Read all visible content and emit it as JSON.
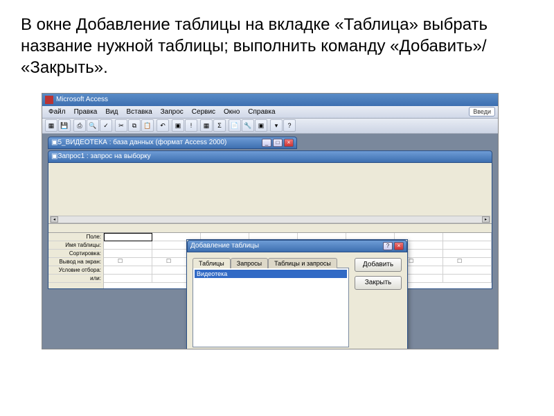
{
  "instruction_text": "В окне Добавление таблицы на вкладке «Таблица» выбрать название нужной таблицы; выполнить команду «Добавить»/ «Закрыть».",
  "app": {
    "title": "Microsoft Access"
  },
  "menu": {
    "items": [
      "Файл",
      "Правка",
      "Вид",
      "Вставка",
      "Запрос",
      "Сервис",
      "Окно",
      "Справка"
    ],
    "right_label": "Введи"
  },
  "db_window": {
    "title": "5_ВИДЕОТЕКА : база данных (формат Access 2000)"
  },
  "query_window": {
    "title": "Запрос1 : запрос на выборку"
  },
  "grid_labels": [
    "Поле:",
    "Имя таблицы:",
    "Сортировка:",
    "Вывод на экран:",
    "Условие отбора:",
    "или:"
  ],
  "dialog": {
    "title": "Добавление таблицы",
    "tabs": [
      "Таблицы",
      "Запросы",
      "Таблицы и запросы"
    ],
    "list_item": "Видеотека",
    "btn_add": "Добавить",
    "btn_close": "Закрыть"
  }
}
